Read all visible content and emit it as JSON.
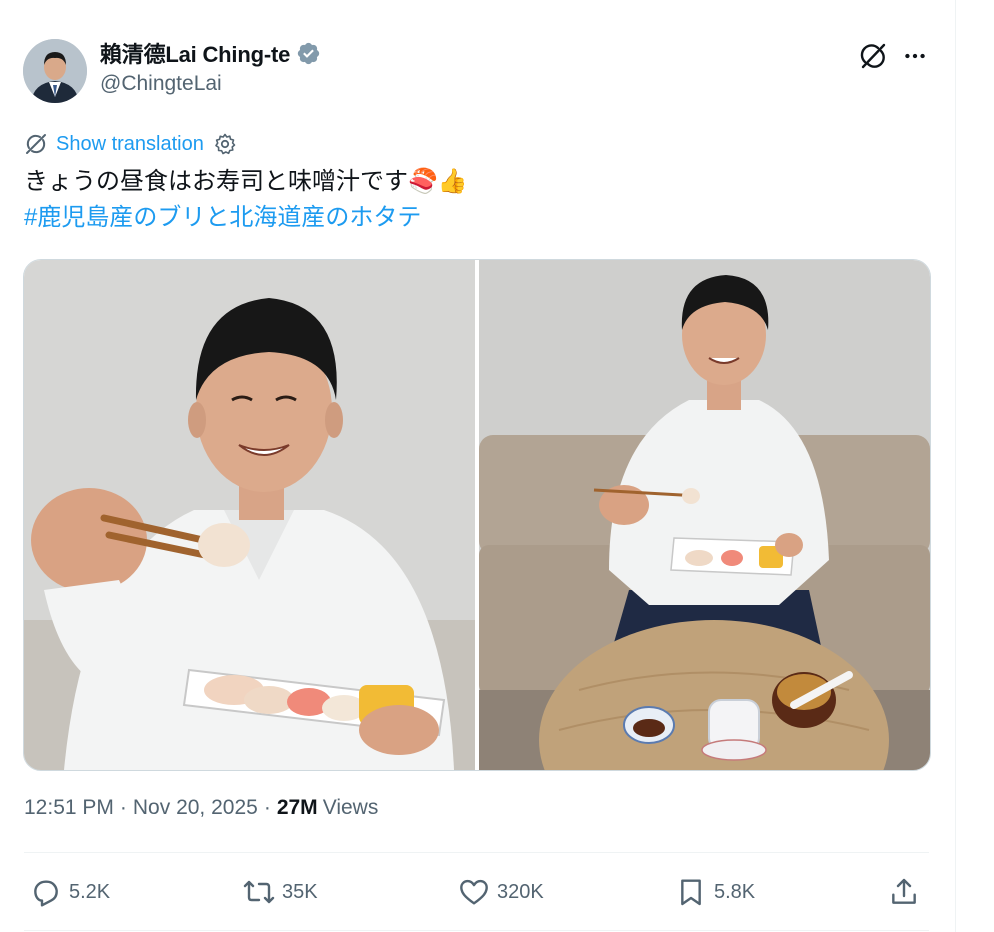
{
  "author": {
    "display_name": "賴清德Lai Ching-te",
    "handle": "@ChingteLai",
    "verified": true,
    "verified_color": "#829aab"
  },
  "translation": {
    "label": "Show translation"
  },
  "tweet": {
    "text": "きょうの昼食はお寿司と味噌汁です🍣👍",
    "hashtag": "#鹿児島産のブリと北海道産のホタテ"
  },
  "media": {
    "photos": [
      {
        "description_icon": "photo-man-holding-sushi-with-chopsticks"
      },
      {
        "description_icon": "photo-man-on-sofa-with-sushi-and-miso-soup"
      }
    ]
  },
  "meta": {
    "time": "12:51 PM",
    "separator": "·",
    "date": "Nov 20, 2025",
    "views_count": "27M",
    "views_label": "Views"
  },
  "actions": {
    "replies": "5.2K",
    "reposts": "35K",
    "likes": "320K",
    "bookmarks": "5.8K"
  },
  "colors": {
    "link": "#1d9bf0",
    "secondary_text": "#536471",
    "primary_text": "#0f1419",
    "border": "#eff3f4"
  },
  "icons": [
    "grok-icon",
    "more-icon",
    "translate-icon",
    "gear-icon",
    "reply-icon",
    "repost-icon",
    "like-icon",
    "bookmark-icon",
    "share-icon"
  ]
}
